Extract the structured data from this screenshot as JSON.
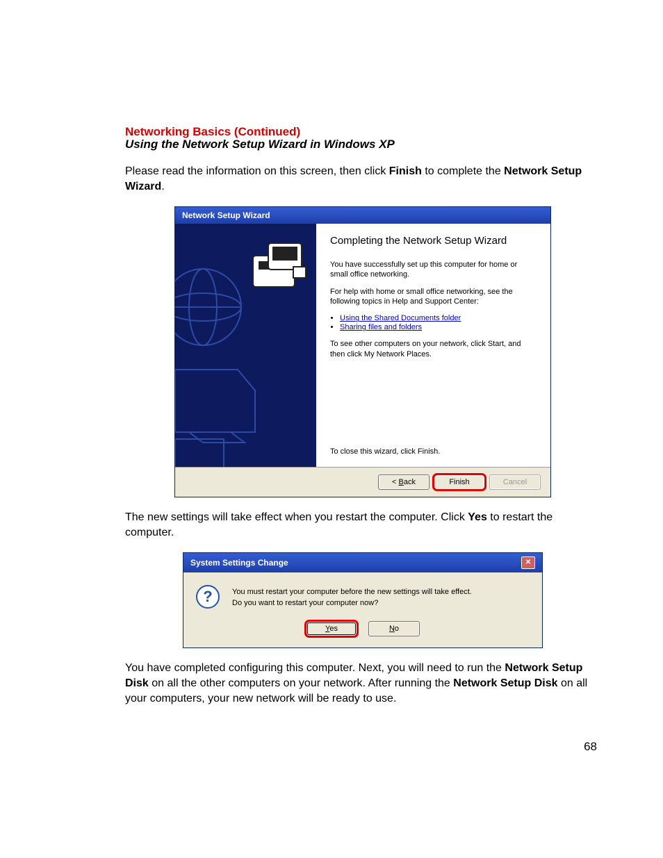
{
  "heading": {
    "red": "Networking Basics (Continued)",
    "sub": "Using the Network Setup Wizard in Windows XP"
  },
  "para1_a": "Please read the information on this screen, then click ",
  "para1_b": "Finish",
  "para1_c": " to complete the ",
  "para1_d": "Network Setup Wizard",
  "para1_e": ".",
  "wizard": {
    "title": "Network Setup Wizard",
    "heading": "Completing the Network Setup Wizard",
    "p1": "You have successfully set up this computer for home or small office networking.",
    "p2": "For help with home or small office networking, see the following topics in Help and Support Center:",
    "link1": "Using the Shared Documents folder",
    "link2": "Sharing files and folders",
    "p3": "To see other computers on your network, click Start, and then click My Network Places.",
    "p4": "To close this wizard, click Finish.",
    "back_pre": "< ",
    "back_u": "B",
    "back_post": "ack",
    "finish": "Finish",
    "cancel": "Cancel"
  },
  "para2_a": "The new settings will take effect when you restart the computer.  Click ",
  "para2_b": "Yes",
  "para2_c": " to restart the computer.",
  "dialog": {
    "title": "System Settings Change",
    "line1": "You must restart your computer before the new settings will take effect.",
    "line2": "Do you want to restart your computer now?",
    "yes_u": "Y",
    "yes_post": "es",
    "no_u": "N",
    "no_post": "o"
  },
  "para3_a": "You have completed configuring this computer.  Next, you will need to run the ",
  "para3_b": "Network Setup Disk",
  "para3_c": " on all the other computers on your network.  After running the ",
  "para3_d": "Network Setup Disk",
  "para3_e": " on all your computers, your new  network will be ready to use.",
  "pageNumber": "68"
}
